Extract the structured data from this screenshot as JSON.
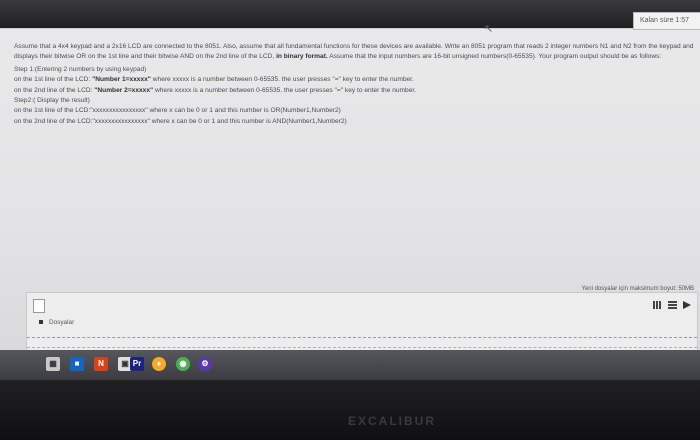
{
  "timer": {
    "label": "Kalan süre 1:57"
  },
  "question": {
    "intro": "Assume that a 4x4 keypad and a 2x16 LCD are connected to the 8051. Also, assume that all fundamental functions for these devices are available. Write an 8051 program that reads 2 integer numbers N1 and N2 from the keypad and displays their bitwise OR on the 1st line and their bitwise AND on the 2nd line of the LCD,",
    "intro_bold": "in binary format.",
    "intro_tail": "Assume that the input numbers are 16-bit unsigned numbers(0-65535). Your program output should be as follows:",
    "step1": "Step 1:(Entering 2 numbers by using keypad)",
    "line1_pre": "on the 1st line of the LCD: ",
    "line1_bold": "\"Number 1=xxxxx\"",
    "line1_post": " where xxxxx is a number between 0-65535. the user presses \"=\" key to enter the number.",
    "line2_pre": "on the 2nd line of the LCD: ",
    "line2_bold": "\"Number 2=xxxxx\"",
    "line2_post": " where xxxxx is a number between 0-65535. the user presses \"=\" key to enter the number.",
    "step2": "Step2:( Display the result)",
    "res1": "on the 1st line of the LCD:\"xxxxxxxxxxxxxxxx\" where x can be 0 or 1  and this number  is OR(Number1,Number2)",
    "res2": "on the 2nd line  of the LCD:\"xxxxxxxxxxxxxxxx\" where x can be 0 or 1  and this number  is AND(Number1,Number2)"
  },
  "upload": {
    "limit": "Yeni dosyalar için maksimum boyut: 50MB",
    "folder_label": "Dosyalar"
  },
  "taskbar": {
    "icons": [
      "chrome-icon",
      "app-icon",
      "pr-icon",
      "firefox-icon",
      "settings-icon"
    ]
  },
  "monitor": {
    "brand": "EXCALIBUR"
  }
}
